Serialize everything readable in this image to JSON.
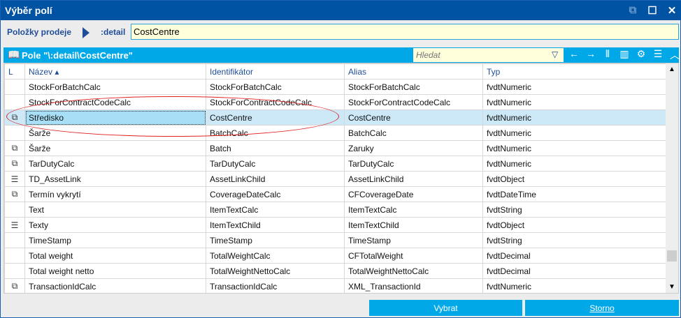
{
  "window": {
    "title": "Výběr polí",
    "buttons": [
      "⧉",
      "☐",
      "✕"
    ]
  },
  "breadcrumb": {
    "label": "Položky prodeje",
    "detail": ":detail",
    "value": "CostCentre"
  },
  "grid": {
    "title": "Pole \"\\:detail\\CostCentre\"",
    "search_placeholder": "Hledat",
    "tools": [
      "←",
      "→",
      "⫴",
      "▥",
      "⚙",
      "☰",
      "︿"
    ],
    "columns": [
      "L",
      "Název ▴",
      "Identifikátor",
      "Alias",
      "Typ"
    ],
    "rows": [
      {
        "icon": "",
        "name": "StockForBatchCalc",
        "id": "StockForBatchCalc",
        "alias": "StockForBatchCalc",
        "type": "fvdtNumeric"
      },
      {
        "icon": "",
        "name": "StockForContractCodeCalc",
        "id": "StockForContractCodeCalc",
        "alias": "StockForContractCodeCalc",
        "type": "fvdtNumeric"
      },
      {
        "icon": "⧉",
        "name": "Středisko",
        "id": "CostCentre",
        "alias": "CostCentre",
        "type": "fvdtNumeric",
        "selected": true
      },
      {
        "icon": "",
        "name": "Šarže",
        "id": "BatchCalc",
        "alias": "BatchCalc",
        "type": "fvdtNumeric"
      },
      {
        "icon": "⧉",
        "name": "Šarže",
        "id": "Batch",
        "alias": "Zaruky",
        "type": "fvdtNumeric"
      },
      {
        "icon": "⧉",
        "name": "TarDutyCalc",
        "id": "TarDutyCalc",
        "alias": "TarDutyCalc",
        "type": "fvdtNumeric"
      },
      {
        "icon": "☰",
        "name": "TD_AssetLink",
        "id": "AssetLinkChild",
        "alias": "AssetLinkChild",
        "type": "fvdtObject"
      },
      {
        "icon": "⧉",
        "name": "Termín vykrytí",
        "id": "CoverageDateCalc",
        "alias": "CFCoverageDate",
        "type": "fvdtDateTime"
      },
      {
        "icon": "",
        "name": "Text",
        "id": "ItemTextCalc",
        "alias": "ItemTextCalc",
        "type": "fvdtString"
      },
      {
        "icon": "☰",
        "name": "Texty",
        "id": "ItemTextChild",
        "alias": "ItemTextChild",
        "type": "fvdtObject"
      },
      {
        "icon": "",
        "name": "TimeStamp",
        "id": "TimeStamp",
        "alias": "TimeStamp",
        "type": "fvdtString"
      },
      {
        "icon": "",
        "name": "Total weight",
        "id": "TotalWeightCalc",
        "alias": "CFTotalWeight",
        "type": "fvdtDecimal"
      },
      {
        "icon": "",
        "name": "Total weight netto",
        "id": "TotalWeightNettoCalc",
        "alias": "TotalWeightNettoCalc",
        "type": "fvdtDecimal"
      },
      {
        "icon": "⧉",
        "name": "TransactionIdCalc",
        "id": "TransactionIdCalc",
        "alias": "XML_TransactionId",
        "type": "fvdtNumeric"
      }
    ]
  },
  "footer": {
    "select": "Vybrat",
    "cancel": "Storno"
  }
}
